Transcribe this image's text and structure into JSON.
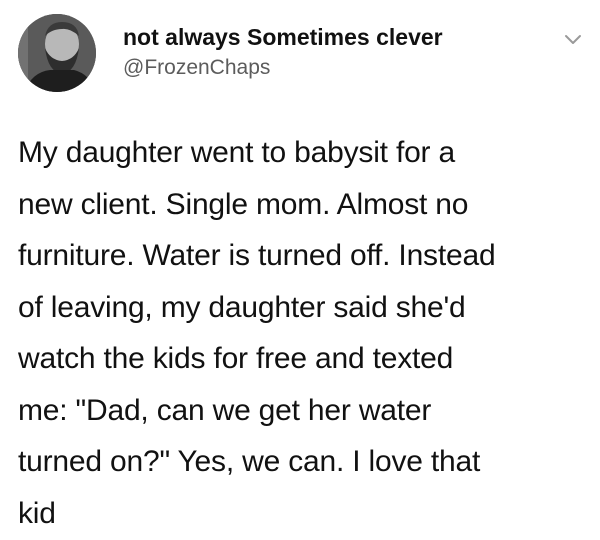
{
  "tweet": {
    "author": {
      "display_name": "not always Sometimes clever",
      "handle": "@FrozenChaps",
      "avatar_icon": "profile-photo-bearded-man"
    },
    "menu_icon": "chevron-down-icon",
    "text_lines": [
      "My daughter went to babysit for a",
      "new client. Single mom. Almost no",
      "furniture. Water is turned off. Instead",
      "of leaving, my daughter said she'd",
      "watch the kids for free and texted",
      "me: \"Dad, can we get her water",
      "turned on?\" Yes, we can. I love that",
      "kid"
    ]
  }
}
